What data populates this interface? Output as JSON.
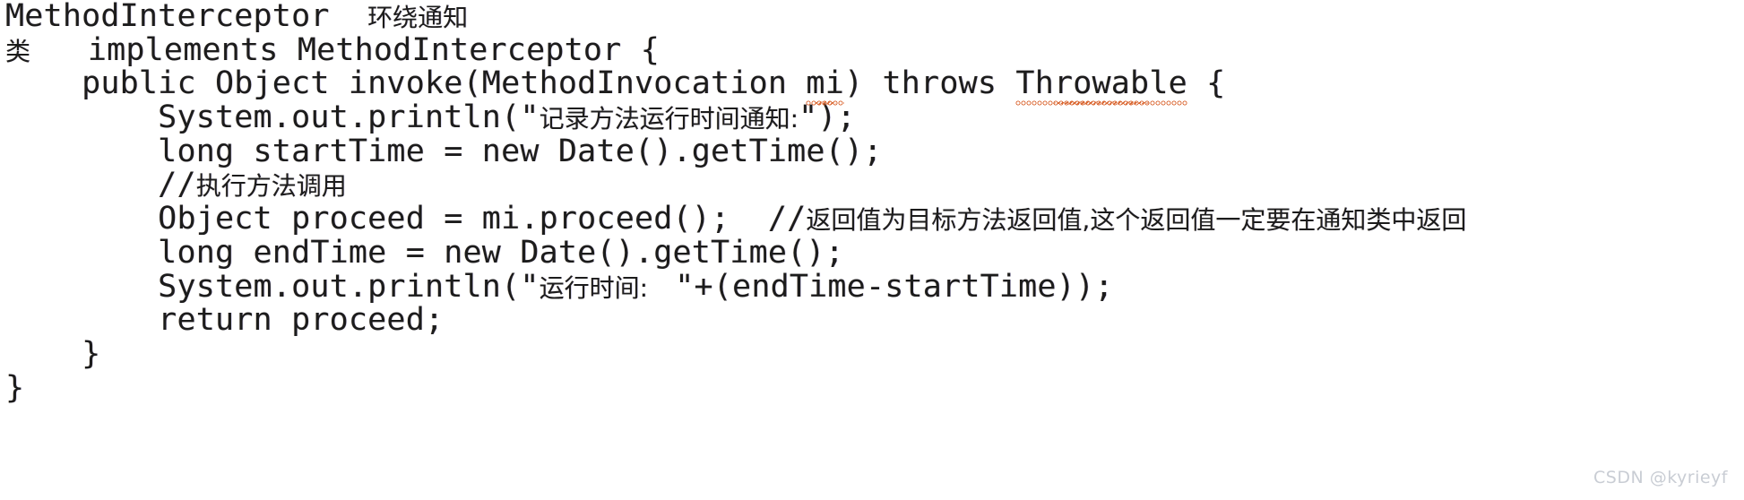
{
  "document": {
    "type": "code-snippet",
    "language": "Java",
    "background_color": "#ffffff",
    "text_color": "#1c1c1c",
    "spellcheck_underline_color": "#d9622b"
  },
  "code": {
    "lines": [
      {
        "id": "line-1",
        "segments": [
          {
            "kind": "latin",
            "text": "MethodInterceptor  "
          },
          {
            "kind": "cjk",
            "text": "环绕通知"
          }
        ]
      },
      {
        "id": "line-2",
        "segments": [
          {
            "kind": "cjk",
            "text": "类"
          },
          {
            "kind": "latin",
            "text": "   implements MethodInterceptor {"
          }
        ]
      },
      {
        "id": "line-3",
        "segments": [
          {
            "kind": "latin",
            "text": "    public Object invoke(MethodInvocation "
          },
          {
            "kind": "latin",
            "text": "mi",
            "squiggle": true
          },
          {
            "kind": "latin",
            "text": ") throws "
          },
          {
            "kind": "latin",
            "text": "Throwable",
            "squiggle": true
          },
          {
            "kind": "latin",
            "text": " {"
          }
        ]
      },
      {
        "id": "line-4",
        "segments": [
          {
            "kind": "latin",
            "text": "        System.out.println(\""
          },
          {
            "kind": "cjk",
            "text": "记录方法运行时间通知:"
          },
          {
            "kind": "latin",
            "text": "\");"
          }
        ]
      },
      {
        "id": "line-5",
        "segments": [
          {
            "kind": "latin",
            "text": "        long startTime = new Date().getTime();"
          }
        ]
      },
      {
        "id": "line-6",
        "segments": [
          {
            "kind": "latin",
            "text": "        //"
          },
          {
            "kind": "cjk",
            "text": "执行方法调用"
          }
        ]
      },
      {
        "id": "line-7",
        "segments": [
          {
            "kind": "latin",
            "text": "        Object proceed = mi.proceed();  //"
          },
          {
            "kind": "cjk",
            "text": "返回值为目标方法返回值,这个返回值一定要在通知类中返回"
          }
        ]
      },
      {
        "id": "line-8",
        "segments": [
          {
            "kind": "latin",
            "text": "        long endTime = new Date().getTime();"
          }
        ]
      },
      {
        "id": "line-9",
        "segments": [
          {
            "kind": "latin",
            "text": "        System.out.println(\""
          },
          {
            "kind": "cjk",
            "text": "运行时间: "
          },
          {
            "kind": "latin",
            "text": " \"+(endTime-startTime));"
          }
        ]
      },
      {
        "id": "line-10",
        "segments": [
          {
            "kind": "latin",
            "text": "        return proceed;"
          }
        ]
      },
      {
        "id": "line-11",
        "segments": [
          {
            "kind": "latin",
            "text": "    }"
          }
        ]
      },
      {
        "id": "line-12",
        "segments": [
          {
            "kind": "latin",
            "text": "}"
          }
        ]
      }
    ]
  },
  "watermark": {
    "text": "CSDN @kyrieyf"
  }
}
